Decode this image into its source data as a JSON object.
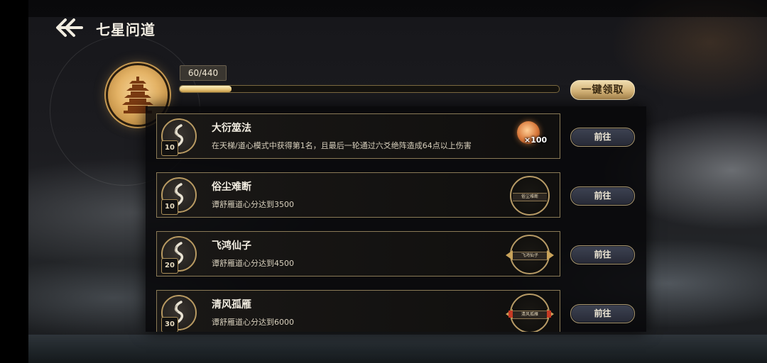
{
  "header": {
    "title": "七星问道",
    "back_icon": "back-arrow-icon"
  },
  "progress": {
    "text": "60/440",
    "current": 60,
    "total": 440
  },
  "claim_all_label": "一键领取",
  "emblem_icon": "pagoda-icon",
  "colors": {
    "gold": "#c79a52",
    "panel": "#0a0a0c",
    "go_button": "#2f3240"
  },
  "tasks": [
    {
      "name": "大衍筮法",
      "desc": "在天梯/道心模式中获得第1名，且最后一轮通过六爻绝阵造成64点以上伤害",
      "level": "10",
      "badge_icon": "wave-swirl-icon",
      "reward_type": "item",
      "reward_icon": "spirit-orb-icon",
      "reward_qty": "×100",
      "action": "前往"
    },
    {
      "name": "俗尘难断",
      "desc": "谭舒雁道心分达到3500",
      "level": "10",
      "badge_icon": "wave-swirl-icon",
      "reward_type": "title",
      "reward_label": "俗尘难断",
      "action": "前往"
    },
    {
      "name": "飞鸿仙子",
      "desc": "谭舒雁道心分达到4500",
      "level": "20",
      "badge_icon": "wave-swirl-icon",
      "reward_type": "title",
      "reward_label": "飞鸿仙子",
      "action": "前往"
    },
    {
      "name": "清风孤雁",
      "desc": "谭舒雁道心分达到6000",
      "level": "30",
      "badge_icon": "wave-swirl-icon",
      "reward_type": "title",
      "reward_label": "清风孤雁",
      "action": "前往"
    }
  ]
}
